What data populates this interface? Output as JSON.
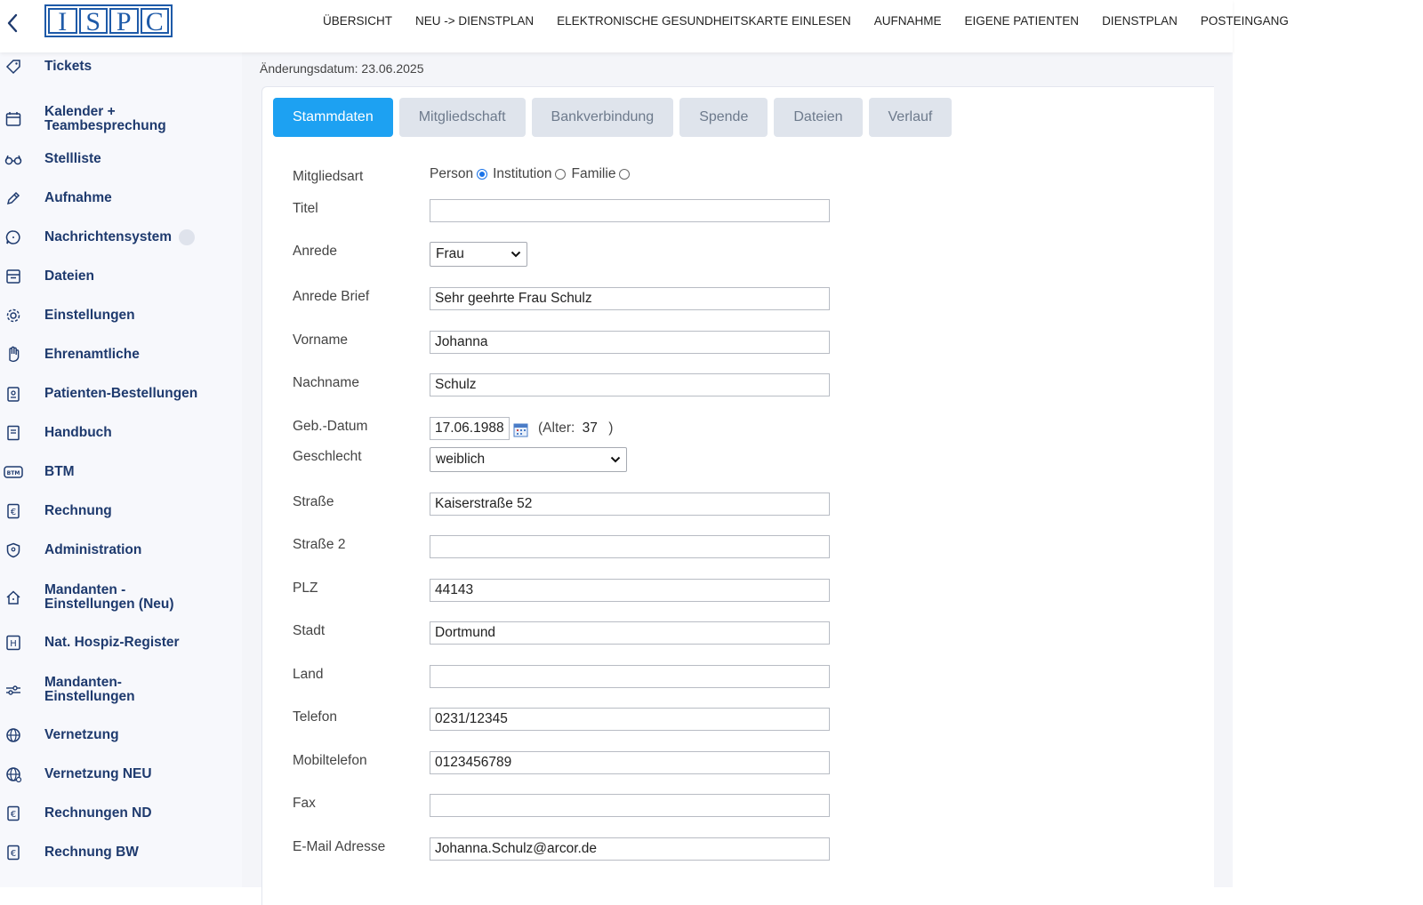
{
  "header": {
    "logo_text": "ISPC",
    "nav": [
      "ÜBERSICHT",
      "NEU -> DIENSTPLAN",
      "ELEKTRONISCHE GESUNDHEITSKARTE EINLESEN",
      "AUFNAHME",
      "EIGENE PATIENTEN",
      "DIENSTPLAN",
      "POSTEINGANG"
    ]
  },
  "sidebar": {
    "items": [
      {
        "label": "Tickets",
        "icon": "ticket-icon"
      },
      {
        "label": "Kalender + Teambesprechung",
        "icon": "calendar-icon"
      },
      {
        "label": "Stellliste",
        "icon": "glasses-icon"
      },
      {
        "label": "Aufnahme",
        "icon": "pencil-icon"
      },
      {
        "label": "Nachrichtensystem",
        "icon": "chat-icon"
      },
      {
        "label": "Dateien",
        "icon": "archive-icon"
      },
      {
        "label": "Einstellungen",
        "icon": "gear-icon"
      },
      {
        "label": "Ehrenamtliche",
        "icon": "hand-icon"
      },
      {
        "label": "Patienten-Bestellungen",
        "icon": "clipboard-icon"
      },
      {
        "label": "Handbuch",
        "icon": "book-icon"
      },
      {
        "label": "BTM",
        "icon": "btm-icon"
      },
      {
        "label": "Rechnung",
        "icon": "euro-icon"
      },
      {
        "label": "Administration",
        "icon": "shield-icon"
      },
      {
        "label": "Mandanten - Einstellungen (Neu)",
        "icon": "home-icon"
      },
      {
        "label": "Nat. Hospiz-Register",
        "icon": "h-icon"
      },
      {
        "label": "Mandanten-Einstellungen",
        "icon": "sliders-icon"
      },
      {
        "label": "Vernetzung",
        "icon": "globe-icon"
      },
      {
        "label": "Vernetzung NEU",
        "icon": "globe-network-icon"
      },
      {
        "label": "Rechnungen ND",
        "icon": "euro-icon"
      },
      {
        "label": "Rechnung BW",
        "icon": "euro-icon"
      }
    ]
  },
  "main": {
    "changed_date": "Änderungsdatum: 23.06.2025",
    "tabs": [
      "Stammdaten",
      "Mitgliedschaft",
      "Bankverbindung",
      "Spende",
      "Dateien",
      "Verlauf"
    ],
    "active_tab": "Stammdaten",
    "form": {
      "mitgliedsart": {
        "label": "Mitgliedsart",
        "options": [
          "Person",
          "Institution",
          "Familie"
        ],
        "selected": "Person"
      },
      "titel": {
        "label": "Titel",
        "value": ""
      },
      "anrede": {
        "label": "Anrede",
        "value": "Frau"
      },
      "anrede_brief": {
        "label": "Anrede Brief",
        "value": "Sehr geehrte Frau Schulz"
      },
      "vorname": {
        "label": "Vorname",
        "value": "Johanna"
      },
      "nachname": {
        "label": "Nachname",
        "value": "Schulz"
      },
      "geb_datum": {
        "label": "Geb.-Datum",
        "value": "17.06.1988",
        "age_prefix": "(Alter:",
        "age": "37",
        "age_suffix": ")"
      },
      "geschlecht": {
        "label": "Geschlecht",
        "value": "weiblich"
      },
      "strasse": {
        "label": "Straße",
        "value": "Kaiserstraße 52"
      },
      "strasse2": {
        "label": "Straße 2",
        "value": ""
      },
      "plz": {
        "label": "PLZ",
        "value": "44143"
      },
      "stadt": {
        "label": "Stadt",
        "value": "Dortmund"
      },
      "land": {
        "label": "Land",
        "value": ""
      },
      "telefon": {
        "label": "Telefon",
        "value": "0231/12345"
      },
      "mobiltelefon": {
        "label": "Mobiltelefon",
        "value": "0123456789"
      },
      "fax": {
        "label": "Fax",
        "value": ""
      },
      "email": {
        "label": "E-Mail Adresse",
        "value": "Johanna.Schulz@arcor.de"
      }
    }
  },
  "colors": {
    "accent": "#1da1f2",
    "nav_text": "#1e3a6e",
    "tab_inactive": "#dfe4ec",
    "logo": "#1e5aa8"
  }
}
